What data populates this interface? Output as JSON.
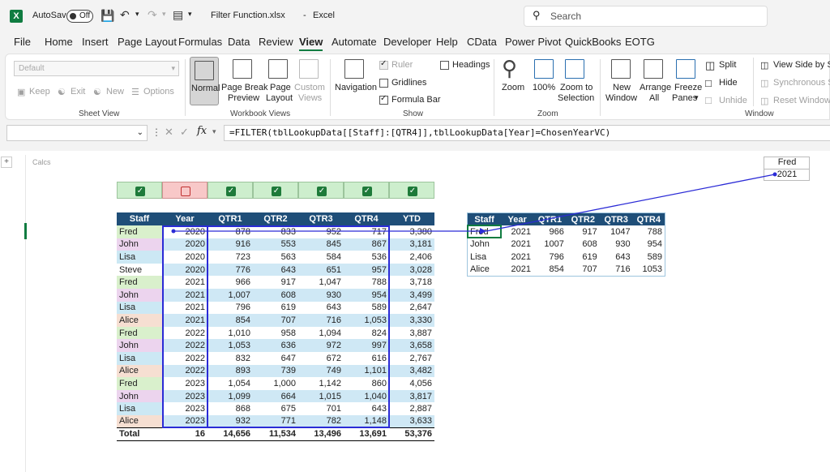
{
  "title_bar": {
    "app_icon": "X",
    "autosave_label": "AutoSave",
    "autosave_state": "Off",
    "filename": "Filter Function.xlsx",
    "separator": "-",
    "app_name": "Excel",
    "search_placeholder": "Search"
  },
  "menu": [
    "File",
    "Home",
    "Insert",
    "Page Layout",
    "Formulas",
    "Data",
    "Review",
    "View",
    "Automate",
    "Developer",
    "Help",
    "CData",
    "Power Pivot",
    "QuickBooks",
    "EOTG"
  ],
  "active_menu": "View",
  "ribbon": {
    "sheet_view": {
      "dropdown_value": "Default",
      "keep": "Keep",
      "exit": "Exit",
      "new": "New",
      "options": "Options",
      "label": "Sheet View"
    },
    "workbook_views": {
      "normal": "Normal",
      "page_break_1": "Page Break",
      "page_break_2": "Preview",
      "page_layout_1": "Page",
      "page_layout_2": "Layout",
      "custom_1": "Custom",
      "custom_2": "Views",
      "label": "Workbook Views"
    },
    "show": {
      "navigation": "Navigation",
      "ruler": "Ruler",
      "gridlines": "Gridlines",
      "formula_bar": "Formula Bar",
      "headings": "Headings",
      "label": "Show"
    },
    "zoom": {
      "zoom": "Zoom",
      "hundred": "100%",
      "zoom_sel_1": "Zoom to",
      "zoom_sel_2": "Selection",
      "label": "Zoom"
    },
    "window": {
      "new_window_1": "New",
      "new_window_2": "Window",
      "arrange_1": "Arrange",
      "arrange_2": "All",
      "freeze_1": "Freeze",
      "freeze_2": "Panes",
      "split": "Split",
      "hide": "Hide",
      "unhide": "Unhide",
      "side_by_side": "View Side by Sid",
      "sync_scroll": "Synchronous Sc",
      "reset_pos": "Reset Window P",
      "label": "Window"
    }
  },
  "formula_bar": {
    "fx": "fx",
    "formula": "=FILTER(tblLookupData[[Staff]:[QTR4]],tblLookupData[Year]=ChosenYearVC)"
  },
  "sheet": {
    "expand_button": "+",
    "calcs_label": "Calcs",
    "criteria_staff": "Fred",
    "criteria_year": "2021",
    "checkbox_flags": [
      true,
      false,
      true,
      true,
      true,
      true,
      true
    ],
    "main_table": {
      "headers": [
        "Staff",
        "Year",
        "QTR1",
        "QTR2",
        "QTR3",
        "QTR4",
        "YTD"
      ],
      "rows": [
        [
          "Fred",
          "2020",
          "878",
          "833",
          "952",
          "717",
          "3,380"
        ],
        [
          "John",
          "2020",
          "916",
          "553",
          "845",
          "867",
          "3,181"
        ],
        [
          "Lisa",
          "2020",
          "723",
          "563",
          "584",
          "536",
          "2,406"
        ],
        [
          "Steve",
          "2020",
          "776",
          "643",
          "651",
          "957",
          "3,028"
        ],
        [
          "Fred",
          "2021",
          "966",
          "917",
          "1,047",
          "788",
          "3,718"
        ],
        [
          "John",
          "2021",
          "1,007",
          "608",
          "930",
          "954",
          "3,499"
        ],
        [
          "Lisa",
          "2021",
          "796",
          "619",
          "643",
          "589",
          "2,647"
        ],
        [
          "Alice",
          "2021",
          "854",
          "707",
          "716",
          "1,053",
          "3,330"
        ],
        [
          "Fred",
          "2022",
          "1,010",
          "958",
          "1,094",
          "824",
          "3,887"
        ],
        [
          "John",
          "2022",
          "1,053",
          "636",
          "972",
          "997",
          "3,658"
        ],
        [
          "Lisa",
          "2022",
          "832",
          "647",
          "672",
          "616",
          "2,767"
        ],
        [
          "Alice",
          "2022",
          "893",
          "739",
          "749",
          "1,101",
          "3,482"
        ],
        [
          "Fred",
          "2023",
          "1,054",
          "1,000",
          "1,142",
          "860",
          "4,056"
        ],
        [
          "John",
          "2023",
          "1,099",
          "664",
          "1,015",
          "1,040",
          "3,817"
        ],
        [
          "Lisa",
          "2023",
          "868",
          "675",
          "701",
          "643",
          "2,887"
        ],
        [
          "Alice",
          "2023",
          "932",
          "771",
          "782",
          "1,148",
          "3,633"
        ]
      ],
      "total": [
        "Total",
        "16",
        "14,656",
        "11,534",
        "13,496",
        "13,691",
        "53,376"
      ]
    },
    "result_table": {
      "headers": [
        "Staff",
        "Year",
        "QTR1",
        "QTR2",
        "QTR3",
        "QTR4"
      ],
      "rows": [
        [
          "Fred",
          "2021",
          "966",
          "917",
          "1047",
          "788"
        ],
        [
          "John",
          "2021",
          "1007",
          "608",
          "930",
          "954"
        ],
        [
          "Lisa",
          "2021",
          "796",
          "619",
          "643",
          "589"
        ],
        [
          "Alice",
          "2021",
          "854",
          "707",
          "716",
          "1053"
        ]
      ]
    }
  }
}
